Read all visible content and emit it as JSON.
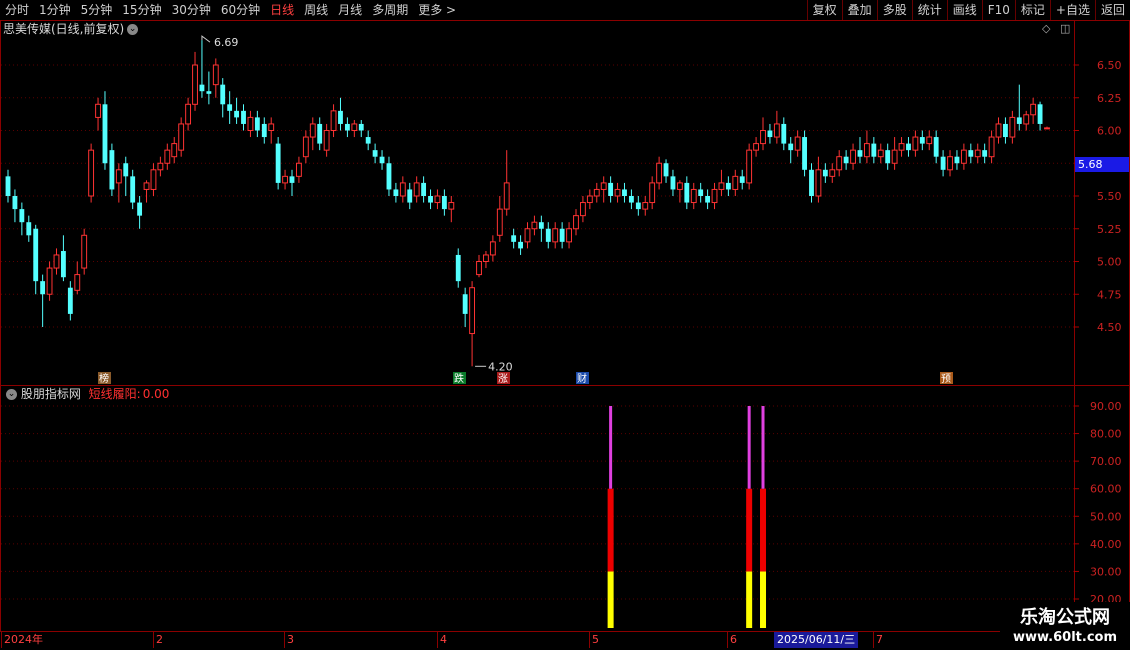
{
  "toolbar": {
    "left_items": [
      "分时",
      "1分钟",
      "5分钟",
      "15分钟",
      "30分钟",
      "60分钟",
      "日线",
      "周线",
      "月线",
      "多周期",
      "更多 >"
    ],
    "active_index": 6,
    "right_items": [
      "复权",
      "叠加",
      "多股",
      "统计",
      "画线",
      "F10",
      "标记",
      "+自选",
      "返回"
    ]
  },
  "stock": {
    "title": "思美传媒(日线,前复权)",
    "current_price": "5.68",
    "high_label": "6.69",
    "low_label": "4.20"
  },
  "price_axis": {
    "ticks": [
      "6.50",
      "6.25",
      "6.00",
      "5.75",
      "5.50",
      "5.25",
      "5.00",
      "4.75",
      "4.50"
    ]
  },
  "event_markers": [
    {
      "label": "榜",
      "bg": "#8a5a2a",
      "color": "#ffffff"
    },
    {
      "label": "跌",
      "bg": "#0a7a2a",
      "color": "#ffffff"
    },
    {
      "label": "涨",
      "bg": "#aa1a1a",
      "color": "#ffffff"
    },
    {
      "label": "财",
      "bg": "#1a4aaa",
      "color": "#ffffff"
    },
    {
      "label": "预",
      "bg": "#aa5a1a",
      "color": "#ffffff"
    }
  ],
  "indicator": {
    "name": "股朋指标网",
    "line_label": "短线履阳:",
    "line_value": "0.00",
    "ticks": [
      "90.00",
      "80.00",
      "70.00",
      "60.00",
      "50.00",
      "40.00",
      "30.00",
      "20.00"
    ]
  },
  "dates": {
    "labels": [
      "2024年",
      "2",
      "3",
      "4",
      "5",
      "6",
      "7"
    ],
    "selected": "2025/06/11/三"
  },
  "watermark": {
    "line1": "乐淘公式网",
    "line2": "www.60lt.com"
  },
  "colors": {
    "up": "#ff3333",
    "down": "#54ffff",
    "bar_top": "#e040e0",
    "bar_mid": "#ee0000",
    "bar_low": "#ffff00"
  },
  "chart_data": {
    "type": "candlestick",
    "candles": [
      [
        5.65,
        5.5,
        5.7,
        5.45
      ],
      [
        5.5,
        5.4,
        5.55,
        5.3
      ],
      [
        5.4,
        5.3,
        5.45,
        5.2
      ],
      [
        5.3,
        5.2,
        5.35,
        5.15
      ],
      [
        5.25,
        4.85,
        5.28,
        4.75
      ],
      [
        4.85,
        4.75,
        4.9,
        4.5
      ],
      [
        4.75,
        4.95,
        5.0,
        4.7
      ],
      [
        4.95,
        5.05,
        5.1,
        4.9
      ],
      [
        5.08,
        4.88,
        5.2,
        4.85
      ],
      [
        4.8,
        4.6,
        4.85,
        4.55
      ],
      [
        4.78,
        4.9,
        5.0,
        4.75
      ],
      [
        4.95,
        5.2,
        5.25,
        4.9
      ],
      [
        5.5,
        5.85,
        5.9,
        5.45
      ],
      [
        6.1,
        6.2,
        6.25,
        6.0
      ],
      [
        6.2,
        5.75,
        6.3,
        5.7
      ],
      [
        5.85,
        5.55,
        5.9,
        5.5
      ],
      [
        5.6,
        5.7,
        5.75,
        5.45
      ],
      [
        5.75,
        5.65,
        5.8,
        5.5
      ],
      [
        5.65,
        5.45,
        5.7,
        5.4
      ],
      [
        5.45,
        5.35,
        5.5,
        5.25
      ],
      [
        5.55,
        5.6,
        5.62,
        5.45
      ],
      [
        5.55,
        5.7,
        5.75,
        5.5
      ],
      [
        5.7,
        5.75,
        5.8,
        5.65
      ],
      [
        5.75,
        5.85,
        5.9,
        5.7
      ],
      [
        5.8,
        5.9,
        5.95,
        5.75
      ],
      [
        5.85,
        6.05,
        6.1,
        5.8
      ],
      [
        6.05,
        6.2,
        6.25,
        6.0
      ],
      [
        6.2,
        6.5,
        6.6,
        6.15
      ],
      [
        6.35,
        6.3,
        6.69,
        6.25
      ],
      [
        6.3,
        6.28,
        6.45,
        6.2
      ],
      [
        6.35,
        6.5,
        6.55,
        6.25
      ],
      [
        6.35,
        6.2,
        6.4,
        6.1
      ],
      [
        6.2,
        6.15,
        6.3,
        6.05
      ],
      [
        6.15,
        6.1,
        6.25,
        6.05
      ],
      [
        6.15,
        6.05,
        6.2,
        6.0
      ],
      [
        6.0,
        6.1,
        6.15,
        5.95
      ],
      [
        6.1,
        6.0,
        6.15,
        5.95
      ],
      [
        6.05,
        5.95,
        6.1,
        5.9
      ],
      [
        6.0,
        6.05,
        6.1,
        5.9
      ],
      [
        5.9,
        5.6,
        5.95,
        5.55
      ],
      [
        5.6,
        5.65,
        5.7,
        5.55
      ],
      [
        5.65,
        5.6,
        5.7,
        5.5
      ],
      [
        5.65,
        5.75,
        5.8,
        5.6
      ],
      [
        5.8,
        5.95,
        6.0,
        5.75
      ],
      [
        5.95,
        6.05,
        6.1,
        5.85
      ],
      [
        6.05,
        5.9,
        6.1,
        5.85
      ],
      [
        5.85,
        6.0,
        6.05,
        5.8
      ],
      [
        6.0,
        6.15,
        6.2,
        5.95
      ],
      [
        6.15,
        6.05,
        6.25,
        6.0
      ],
      [
        6.05,
        6.0,
        6.1,
        5.95
      ],
      [
        6.0,
        6.05,
        6.08,
        5.95
      ],
      [
        6.05,
        6.0,
        6.08,
        5.95
      ],
      [
        5.95,
        5.9,
        6.0,
        5.85
      ],
      [
        5.85,
        5.8,
        5.9,
        5.75
      ],
      [
        5.8,
        5.75,
        5.85,
        5.7
      ],
      [
        5.75,
        5.55,
        5.8,
        5.5
      ],
      [
        5.55,
        5.5,
        5.6,
        5.45
      ],
      [
        5.5,
        5.6,
        5.65,
        5.45
      ],
      [
        5.55,
        5.45,
        5.6,
        5.4
      ],
      [
        5.5,
        5.6,
        5.65,
        5.45
      ],
      [
        5.6,
        5.5,
        5.65,
        5.45
      ],
      [
        5.5,
        5.45,
        5.55,
        5.4
      ],
      [
        5.45,
        5.5,
        5.55,
        5.4
      ],
      [
        5.5,
        5.4,
        5.55,
        5.35
      ],
      [
        5.4,
        5.45,
        5.5,
        5.3
      ],
      [
        5.05,
        4.85,
        5.1,
        4.8
      ],
      [
        4.75,
        4.6,
        4.8,
        4.5
      ],
      [
        4.45,
        4.8,
        4.85,
        4.2
      ],
      [
        4.9,
        5.0,
        5.05,
        4.88
      ],
      [
        5.0,
        5.05,
        5.08,
        4.95
      ],
      [
        5.05,
        5.15,
        5.2,
        5.0
      ],
      [
        5.2,
        5.4,
        5.5,
        5.15
      ],
      [
        5.4,
        5.6,
        5.85,
        5.35
      ],
      [
        5.2,
        5.15,
        5.25,
        5.1
      ],
      [
        5.15,
        5.1,
        5.2,
        5.05
      ],
      [
        5.15,
        5.25,
        5.3,
        5.1
      ],
      [
        5.25,
        5.3,
        5.35,
        5.2
      ],
      [
        5.3,
        5.25,
        5.35,
        5.15
      ],
      [
        5.25,
        5.15,
        5.3,
        5.1
      ],
      [
        5.15,
        5.25,
        5.3,
        5.1
      ],
      [
        5.25,
        5.15,
        5.3,
        5.1
      ],
      [
        5.15,
        5.25,
        5.3,
        5.1
      ],
      [
        5.25,
        5.35,
        5.4,
        5.2
      ],
      [
        5.35,
        5.45,
        5.5,
        5.3
      ],
      [
        5.45,
        5.5,
        5.55,
        5.4
      ],
      [
        5.5,
        5.55,
        5.6,
        5.45
      ],
      [
        5.55,
        5.6,
        5.65,
        5.45
      ],
      [
        5.6,
        5.5,
        5.65,
        5.45
      ],
      [
        5.5,
        5.55,
        5.6,
        5.45
      ],
      [
        5.55,
        5.5,
        5.6,
        5.45
      ],
      [
        5.5,
        5.45,
        5.55,
        5.4
      ],
      [
        5.45,
        5.4,
        5.5,
        5.35
      ],
      [
        5.4,
        5.45,
        5.5,
        5.35
      ],
      [
        5.45,
        5.6,
        5.65,
        5.4
      ],
      [
        5.6,
        5.75,
        5.8,
        5.55
      ],
      [
        5.75,
        5.65,
        5.78,
        5.6
      ],
      [
        5.65,
        5.55,
        5.7,
        5.5
      ],
      [
        5.55,
        5.6,
        5.62,
        5.45
      ],
      [
        5.6,
        5.45,
        5.65,
        5.4
      ],
      [
        5.45,
        5.55,
        5.6,
        5.4
      ],
      [
        5.55,
        5.5,
        5.6,
        5.45
      ],
      [
        5.5,
        5.45,
        5.55,
        5.4
      ],
      [
        5.45,
        5.55,
        5.6,
        5.4
      ],
      [
        5.55,
        5.6,
        5.7,
        5.5
      ],
      [
        5.6,
        5.55,
        5.65,
        5.5
      ],
      [
        5.55,
        5.65,
        5.7,
        5.5
      ],
      [
        5.65,
        5.6,
        5.7,
        5.55
      ],
      [
        5.6,
        5.85,
        5.9,
        5.55
      ],
      [
        5.85,
        5.9,
        5.95,
        5.8
      ],
      [
        5.9,
        6.0,
        6.1,
        5.85
      ],
      [
        6.0,
        5.95,
        6.05,
        5.9
      ],
      [
        5.95,
        6.05,
        6.15,
        5.9
      ],
      [
        6.05,
        5.9,
        6.1,
        5.85
      ],
      [
        5.9,
        5.85,
        5.95,
        5.75
      ],
      [
        5.85,
        5.95,
        6.0,
        5.8
      ],
      [
        5.95,
        5.7,
        6.0,
        5.65
      ],
      [
        5.7,
        5.5,
        5.75,
        5.45
      ],
      [
        5.5,
        5.7,
        5.8,
        5.45
      ],
      [
        5.7,
        5.65,
        5.75,
        5.6
      ],
      [
        5.65,
        5.7,
        5.75,
        5.6
      ],
      [
        5.7,
        5.8,
        5.85,
        5.65
      ],
      [
        5.8,
        5.75,
        5.85,
        5.7
      ],
      [
        5.75,
        5.85,
        5.9,
        5.7
      ],
      [
        5.85,
        5.8,
        5.95,
        5.75
      ],
      [
        5.8,
        5.9,
        6.0,
        5.75
      ],
      [
        5.9,
        5.8,
        5.95,
        5.75
      ],
      [
        5.8,
        5.85,
        5.9,
        5.75
      ],
      [
        5.85,
        5.75,
        5.9,
        5.7
      ],
      [
        5.75,
        5.85,
        5.95,
        5.7
      ],
      [
        5.85,
        5.9,
        5.95,
        5.8
      ],
      [
        5.9,
        5.85,
        5.95,
        5.8
      ],
      [
        5.85,
        5.95,
        6.0,
        5.8
      ],
      [
        5.95,
        5.9,
        6.0,
        5.85
      ],
      [
        5.9,
        5.95,
        6.0,
        5.85
      ],
      [
        5.95,
        5.8,
        6.0,
        5.75
      ],
      [
        5.8,
        5.7,
        5.85,
        5.65
      ],
      [
        5.7,
        5.8,
        5.85,
        5.65
      ],
      [
        5.8,
        5.75,
        5.85,
        5.7
      ],
      [
        5.75,
        5.85,
        5.9,
        5.7
      ],
      [
        5.85,
        5.8,
        5.9,
        5.75
      ],
      [
        5.8,
        5.85,
        5.9,
        5.75
      ],
      [
        5.85,
        5.8,
        5.9,
        5.75
      ],
      [
        5.8,
        5.95,
        6.0,
        5.75
      ],
      [
        5.95,
        6.05,
        6.1,
        5.9
      ],
      [
        6.05,
        5.95,
        6.1,
        5.9
      ],
      [
        5.95,
        6.1,
        6.15,
        5.9
      ],
      [
        6.1,
        6.05,
        6.35,
        6.0
      ],
      [
        6.05,
        6.12,
        6.15,
        6.0
      ],
      [
        6.12,
        6.2,
        6.25,
        6.05
      ],
      [
        6.2,
        6.05,
        6.22,
        6.0
      ],
      [
        6.02,
        6.02,
        6.03,
        6.01
      ]
    ],
    "indicator_bars": [
      {
        "index": 87,
        "segments": [
          30,
          60,
          90
        ]
      },
      {
        "index": 107,
        "segments": [
          30,
          60,
          90
        ]
      },
      {
        "index": 109,
        "segments": [
          30,
          60,
          90
        ]
      }
    ],
    "price_range": [
      4.2,
      6.69
    ],
    "indicator_range": [
      20,
      90
    ]
  }
}
